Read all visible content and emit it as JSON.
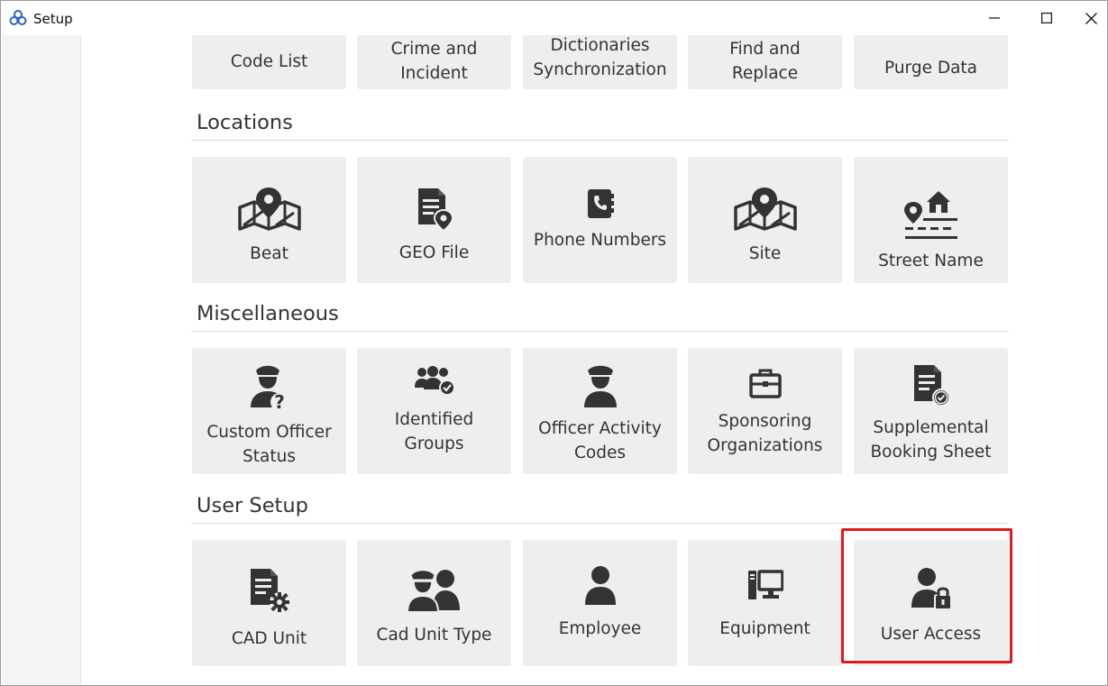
{
  "window": {
    "title": "Setup",
    "app_icon": "app-logo-icon",
    "controls": {
      "minimize": "minimize-icon",
      "maximize": "maximize-icon",
      "close": "close-icon"
    }
  },
  "top_row": [
    {
      "label_lines": [
        "Code List"
      ]
    },
    {
      "label_lines": [
        "Crime and",
        "Incident"
      ]
    },
    {
      "label_lines": [
        "Dictionaries",
        "Synchronization"
      ]
    },
    {
      "label_lines": [
        "Find and",
        "Replace"
      ]
    },
    {
      "label_lines": [
        "Purge Data"
      ]
    }
  ],
  "sections": {
    "locations": {
      "title": "Locations",
      "items": [
        {
          "label_lines": [
            "Beat"
          ],
          "icon": "map-pin-icon"
        },
        {
          "label_lines": [
            "GEO File"
          ],
          "icon": "geo-file-icon"
        },
        {
          "label_lines": [
            "Phone Numbers"
          ],
          "icon": "address-book-icon"
        },
        {
          "label_lines": [
            "Site"
          ],
          "icon": "map-pin-icon"
        },
        {
          "label_lines": [
            "Street Name"
          ],
          "icon": "street-house-icon"
        }
      ]
    },
    "miscellaneous": {
      "title": "Miscellaneous",
      "items": [
        {
          "label_lines": [
            "Custom Officer",
            "Status"
          ],
          "icon": "officer-question-icon"
        },
        {
          "label_lines": [
            "Identified",
            "Groups"
          ],
          "icon": "group-check-icon"
        },
        {
          "label_lines": [
            "Officer Activity",
            "Codes"
          ],
          "icon": "officer-icon"
        },
        {
          "label_lines": [
            "Sponsoring",
            "Organizations"
          ],
          "icon": "briefcase-icon"
        },
        {
          "label_lines": [
            "Supplemental",
            "Booking Sheet"
          ],
          "icon": "document-check-icon"
        }
      ]
    },
    "user_setup": {
      "title": "User Setup",
      "items": [
        {
          "label_lines": [
            "CAD Unit"
          ],
          "icon": "document-gear-icon"
        },
        {
          "label_lines": [
            "Cad Unit Type"
          ],
          "icon": "officer-user-icon"
        },
        {
          "label_lines": [
            "Employee"
          ],
          "icon": "user-icon"
        },
        {
          "label_lines": [
            "Equipment"
          ],
          "icon": "computer-icon"
        },
        {
          "label_lines": [
            "User Access"
          ],
          "icon": "user-lock-icon"
        }
      ]
    }
  },
  "highlight": {
    "target": "User Access",
    "color": "#e0191c"
  },
  "colors": {
    "tile_bg": "#eeeeee",
    "icon": "#333333",
    "sidebar_bg": "#f4f4f4"
  }
}
